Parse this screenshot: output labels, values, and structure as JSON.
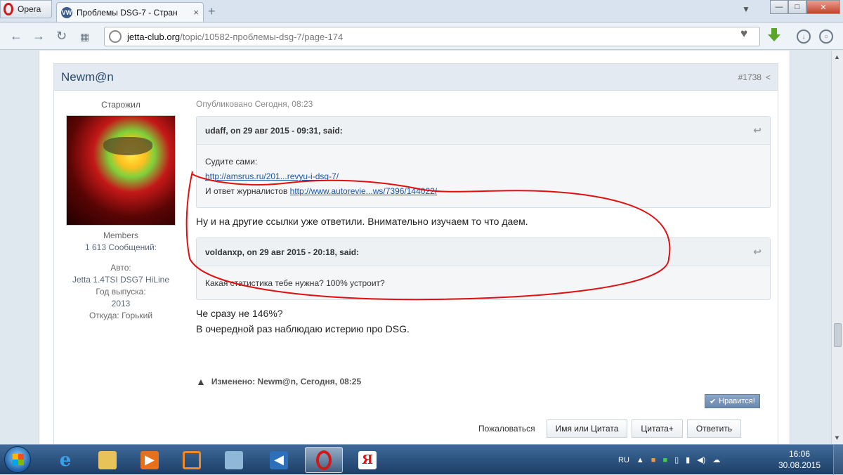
{
  "browser": {
    "menu_label": "Opera",
    "tab_title": "Проблемы DSG-7 - Стран",
    "tab_close": "×",
    "new_tab": "+",
    "url_domain": "jetta-club.org",
    "url_path": "/topic/10582-проблемы-dsg-7/page-174"
  },
  "post": {
    "author": "Newm@n",
    "number": "#1738",
    "rank": "Старожил",
    "group": "Members",
    "posts_count": "1 613 Сообщений:",
    "car_label": "Авто:",
    "car_value": "Jetta 1.4TSI DSG7 HiLine",
    "year_label": "Год выпуска:",
    "year_value": "2013",
    "from_label": "Откуда: Горький",
    "published": "Опубликовано Сегодня, 08:23",
    "quote1": {
      "header": "udaff, on 29 авг 2015 - 09:31, said:",
      "line1": "Судите сами:",
      "link1": "http://amsrus.ru/201...revyu-i-dsg-7/",
      "line3_prefix": "И ответ журналистов ",
      "link2": "http://www.autorevie...ws/7396/144022/"
    },
    "reply1": "Ну и на другие ссылки уже ответили. Внимательно изучаем то что даем.",
    "quote2": {
      "header": "voldanxp, on 29 авг 2015 - 20:18, said:",
      "line1": "Какая статистика тебе нужна? 100% устроит?"
    },
    "reply2_line1": "Че сразу не 146%?",
    "reply2_line2": "В очередной раз наблюдаю истерию про DSG.",
    "edited": "Изменено: Newm@n, Сегодня, 08:25",
    "like": "Нравится!",
    "report": "Пожаловаться",
    "btn_multi_quote": "Имя или Цитата",
    "btn_quote": "Цитата+",
    "btn_reply": "Ответить"
  },
  "taskbar": {
    "lang": "RU",
    "time": "16:06",
    "date": "30.08.2015",
    "apps": [
      "internet-explorer",
      "explorer",
      "media-player",
      "app-orange",
      "photo-viewer",
      "volume-app",
      "opera",
      "yandex"
    ]
  },
  "colors": {
    "annotation_red": "#e01010",
    "link_blue": "#1d57a8"
  }
}
